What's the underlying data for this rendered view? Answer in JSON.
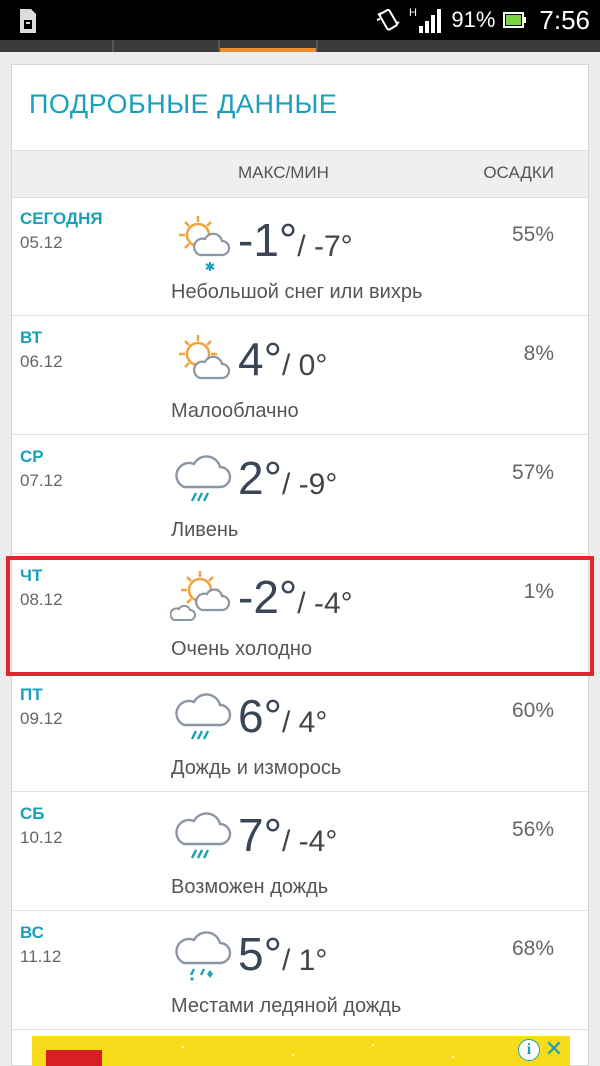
{
  "status_bar": {
    "battery_percent": "91%",
    "time": "7:56",
    "network_letter": "H",
    "icons": [
      "sim-icon",
      "vibrate-icon",
      "signal-icon",
      "battery-icon"
    ]
  },
  "header": {
    "title": "ПОДРОБНЫЕ ДАННЫЕ"
  },
  "columns": {
    "maxmin": "МАКС/МИН",
    "precip": "ОСАДКИ"
  },
  "forecast": [
    {
      "day": "СЕГОДНЯ",
      "date": "05.12",
      "max": "-1°",
      "min": "/ -7°",
      "precip": "55%",
      "desc": "Небольшой снег или вихрь",
      "icon": "sun-cloud-snow-icon"
    },
    {
      "day": "ВТ",
      "date": "06.12",
      "max": "4°",
      "min": "/ 0°",
      "precip": "8%",
      "desc": "Малооблачно",
      "icon": "partly-cloudy-icon"
    },
    {
      "day": "СР",
      "date": "07.12",
      "max": "2°",
      "min": "/ -9°",
      "precip": "57%",
      "desc": "Ливень",
      "icon": "rain-cloud-icon"
    },
    {
      "day": "ЧТ",
      "date": "08.12",
      "max": "-2°",
      "min": "/ -4°",
      "precip": "1%",
      "desc": "Очень холодно",
      "icon": "sun-two-clouds-icon"
    },
    {
      "day": "ПТ",
      "date": "09.12",
      "max": "6°",
      "min": "/ 4°",
      "precip": "60%",
      "desc": "Дождь и изморось",
      "icon": "rain-cloud-icon"
    },
    {
      "day": "СБ",
      "date": "10.12",
      "max": "7°",
      "min": "/ -4°",
      "precip": "56%",
      "desc": "Возможен дождь",
      "icon": "rain-cloud-icon"
    },
    {
      "day": "ВС",
      "date": "11.12",
      "max": "5°",
      "min": "/ 1°",
      "precip": "68%",
      "desc": "Местами ледяной дождь",
      "icon": "freezing-rain-cloud-icon"
    }
  ],
  "ad": {
    "info_label": "i",
    "close_label": "✕"
  },
  "colors": {
    "accent": "#1aa0b8",
    "sun": "#f2a33a",
    "highlight": "#e0262e",
    "ad_background": "#f8dc1c"
  }
}
